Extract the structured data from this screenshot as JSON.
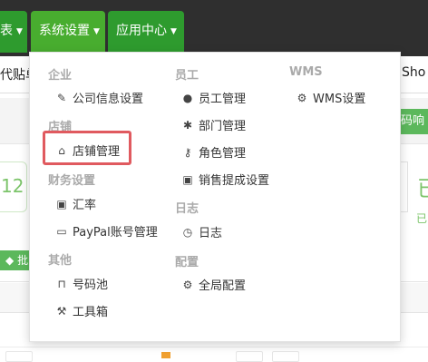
{
  "nav": {
    "tabs": [
      {
        "label": "表",
        "active": false
      },
      {
        "label": "系统设置",
        "active": true
      },
      {
        "label": "应用中心",
        "active": false
      }
    ]
  },
  "background": {
    "subbar_left": "代贴单",
    "subbar_right": "Sho",
    "green_button": "码响",
    "left_card_value": "12",
    "right_card_big": "已",
    "right_card_small": "已",
    "tag_button": "批"
  },
  "menu": {
    "groups": [
      {
        "title": "企业",
        "items": [
          {
            "label": "公司信息设置",
            "icon": "edit-icon",
            "glyph": "✎"
          }
        ]
      },
      {
        "title": "店铺",
        "items": [
          {
            "label": "店铺管理",
            "icon": "home-icon",
            "glyph": "⌂"
          }
        ]
      },
      {
        "title": "财务设置",
        "items": [
          {
            "label": "汇率",
            "icon": "money-icon",
            "glyph": "▣"
          },
          {
            "label": "PayPal账号管理",
            "icon": "credit-card-icon",
            "glyph": "▭"
          }
        ]
      },
      {
        "title": "其他",
        "items": [
          {
            "label": "号码池",
            "icon": "inbox-icon",
            "glyph": "⊓"
          },
          {
            "label": "工具箱",
            "icon": "gavel-icon",
            "glyph": "⚒"
          }
        ]
      },
      {
        "title": "员工",
        "items": [
          {
            "label": "员工管理",
            "icon": "user-icon",
            "glyph": "●"
          },
          {
            "label": "部门管理",
            "icon": "asterisk-icon",
            "glyph": "✱"
          },
          {
            "label": "角色管理",
            "icon": "key-icon",
            "glyph": "⚷"
          },
          {
            "label": "销售提成设置",
            "icon": "money-icon",
            "glyph": "▣"
          }
        ]
      },
      {
        "title": "日志",
        "items": [
          {
            "label": "日志",
            "icon": "clock-icon",
            "glyph": "◷"
          }
        ]
      },
      {
        "title": "配置",
        "items": [
          {
            "label": "全局配置",
            "icon": "gear-icon",
            "glyph": "⚙"
          }
        ]
      },
      {
        "title": "WMS",
        "items": [
          {
            "label": "WMS设置",
            "icon": "gear-icon",
            "glyph": "⚙"
          }
        ]
      }
    ]
  },
  "colors": {
    "topbar": "#2f2f2f",
    "tab_green": "#2e9b2e",
    "tab_active": "#48ad2f",
    "highlight_border": "#e05a5f"
  }
}
